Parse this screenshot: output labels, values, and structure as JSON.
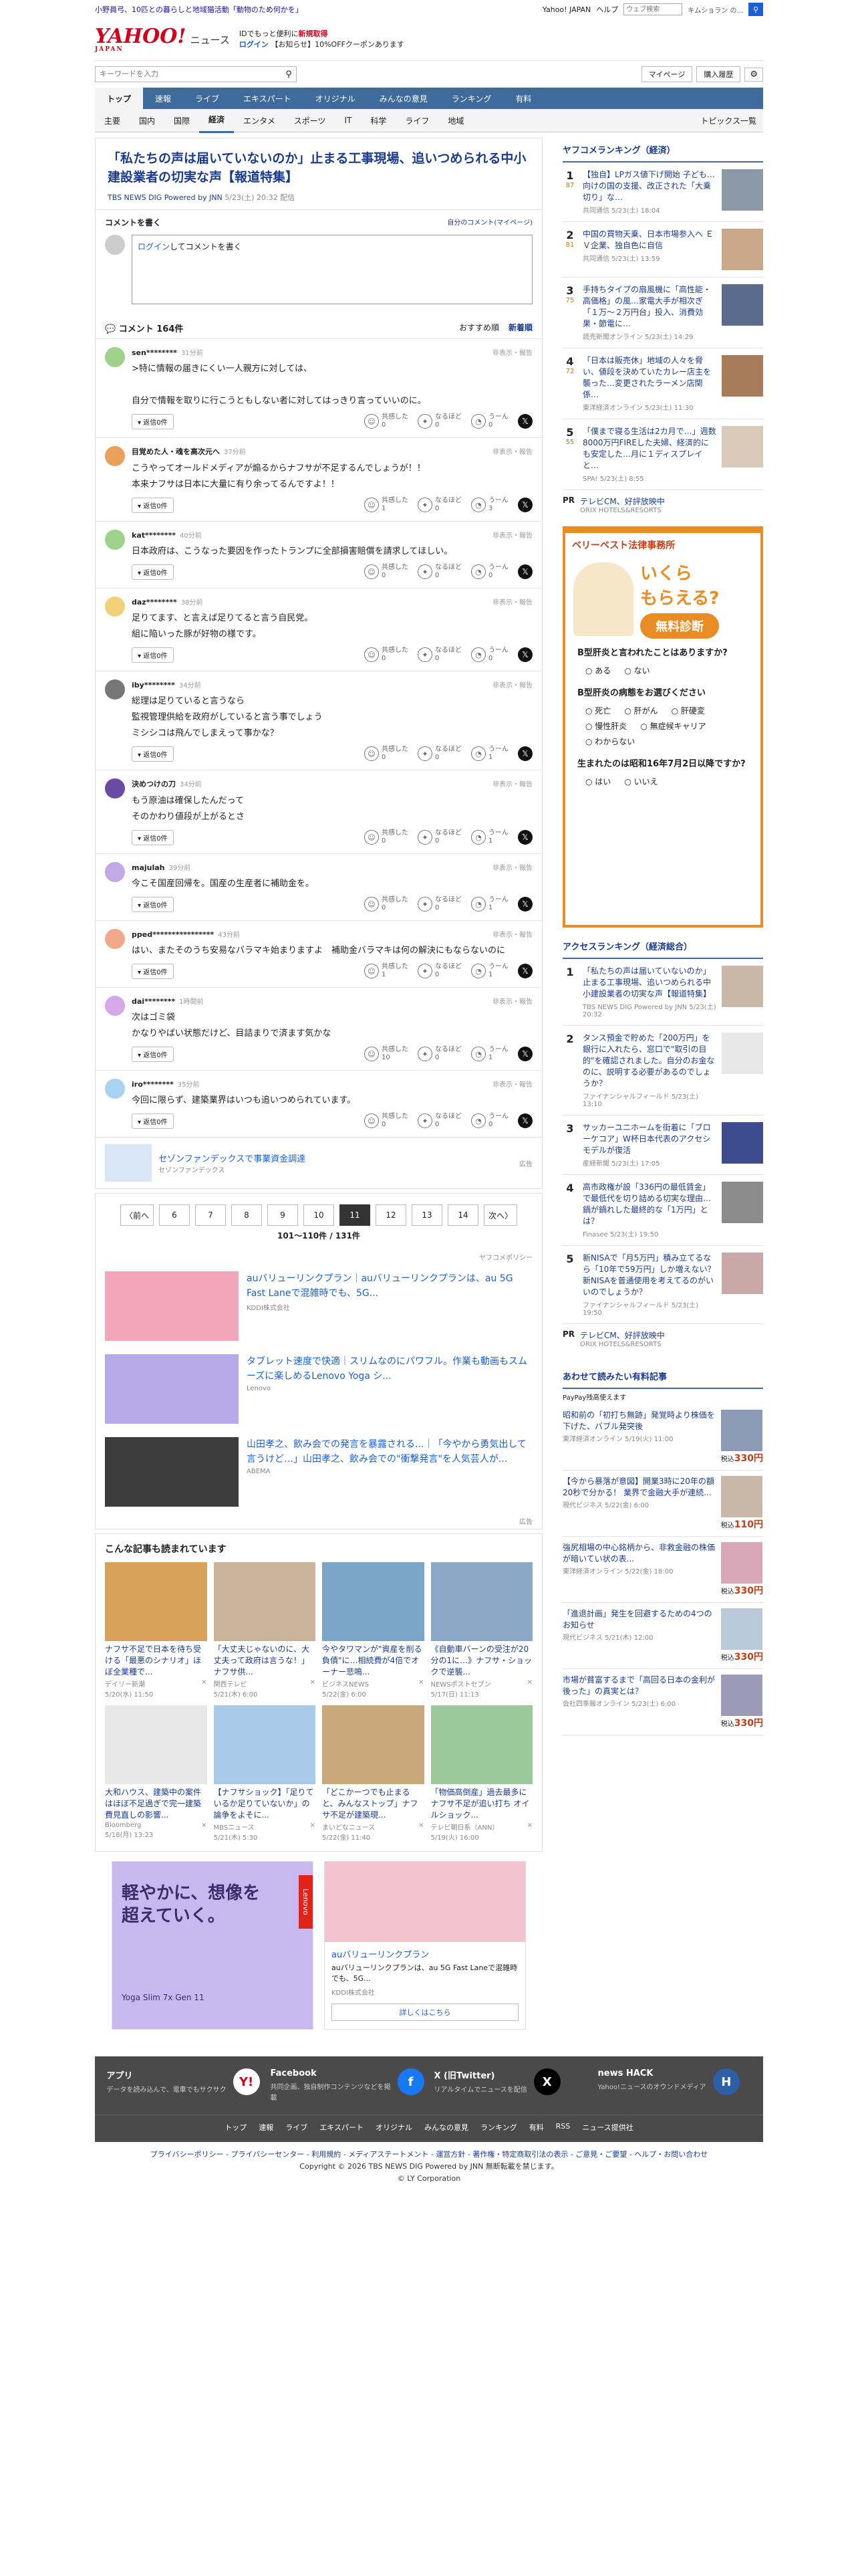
{
  "topbar": {
    "promo_link": "小野員弓、10匹との暮らしと地域猫活動「動物のため何かを」",
    "links": [
      "Yahoo! JAPAN",
      "ヘルプ"
    ],
    "search_placeholder": "ウェブ検索",
    "search_hint": "キムショラン の..."
  },
  "header": {
    "logo": "YAHOO!",
    "logo_sub": "JAPAN",
    "service": "ニュース",
    "promo_line1": "IDでもっと便利に",
    "promo_red": "新規取得",
    "promo_login": "ログイン",
    "promo_line2": "【お知らせ】10%OFFクーポンあります",
    "search_placeholder": "キーワードを入力",
    "mypage": "マイページ",
    "purchase": "購入履歴"
  },
  "nav_main": [
    {
      "label": "トップ",
      "active": true
    },
    {
      "label": "速報"
    },
    {
      "label": "ライブ"
    },
    {
      "label": "エキスパート"
    },
    {
      "label": "オリジナル"
    },
    {
      "label": "みんなの意見"
    },
    {
      "label": "ランキング"
    },
    {
      "label": "有料"
    }
  ],
  "nav_sub": [
    {
      "label": "主要"
    },
    {
      "label": "国内"
    },
    {
      "label": "国際"
    },
    {
      "label": "経済",
      "active": true
    },
    {
      "label": "エンタメ"
    },
    {
      "label": "スポーツ"
    },
    {
      "label": "IT"
    },
    {
      "label": "科学"
    },
    {
      "label": "ライフ"
    },
    {
      "label": "地域"
    }
  ],
  "nav_sub_right": "トピックス一覧",
  "article": {
    "title": "「私たちの声は届いていないのか」止まる工事現場、追いつめられる中小建設業者の切実な声【報道特集】",
    "source": "TBS NEWS DIG Powered by JNN",
    "date": "5/23(土) 20:32 配信"
  },
  "comment_form": {
    "heading": "コメントを書く",
    "my_comments": "自分のコメント(マイページ)",
    "login": "ログイン",
    "placeholder": "してコメントを書く"
  },
  "comments_header": {
    "count": "コメント 164件",
    "sort_recommended": "おすすめ順",
    "sort_new": "新着順"
  },
  "reaction_labels": {
    "agree": "共感した",
    "insight": "なるほど",
    "hmm": "うーん",
    "reply": "返信0件",
    "report": "非表示・報告"
  },
  "comments": [
    {
      "user": "sen********",
      "time": "31分前",
      "text": ">特に情報の届きにくい一人親方に対しては、\n\n自分で情報を取りに行こうともしない者に対してはっきり言っていいのに。",
      "agree": "0",
      "insight": "0",
      "hmm": "0",
      "color": "#9ed28b"
    },
    {
      "user": "目覚めた人・魂を高次元へ",
      "time": "37分前",
      "text": "こうやってオールドメディアが煽るからナフサが不足するんでしょうが！！\n本来ナフサは日本に大量に有り余ってるんですよ！！",
      "agree": "1",
      "insight": "0",
      "hmm": "3",
      "color": "#e9a15a"
    },
    {
      "user": "kat********",
      "time": "40分前",
      "text": "日本政府は、こうなった要因を作ったトランプに全部損害賠償を請求してほしい。",
      "agree": "0",
      "insight": "0",
      "hmm": "0",
      "color": "#9ed28b"
    },
    {
      "user": "daz********",
      "time": "38分前",
      "text": "足りてます、と言えば足りてると言う自民党。\n組に陥いった豚が好物の様です。",
      "agree": "0",
      "insight": "0",
      "hmm": "0",
      "color": "#f1d27a"
    },
    {
      "user": "iby********",
      "time": "34分前",
      "text": "総理は足りていると言うなら\n監視管理供給を政府がしていると言う事でしょう\nミシシコは飛んでしまえって事かな？",
      "agree": "0",
      "insight": "0",
      "hmm": "1",
      "color": "#777777"
    },
    {
      "user": "決めつけの刀",
      "time": "34分前",
      "text": "もう原油は確保したんだって\nそのかわり値段が上がるとさ",
      "agree": "0",
      "insight": "0",
      "hmm": "1",
      "color": "#6a4ba2"
    },
    {
      "user": "majulah",
      "time": "39分前",
      "text": "今こそ国産回帰を。国産の生産者に補助金を。",
      "agree": "0",
      "insight": "0",
      "hmm": "1",
      "color": "#c3a8e8"
    },
    {
      "user": "pped****************",
      "time": "43分前",
      "text": "はい、またそのうち安易なバラマキ始まりますよ　補助金バラマキは何の解決にもならないのに",
      "agree": "1",
      "insight": "0",
      "hmm": "1",
      "color": "#f0a98a"
    },
    {
      "user": "dai********",
      "time": "1時間前",
      "text": "次はゴミ袋\nかなりやばい状態だけど、目詰まりで済ます気かな",
      "agree": "10",
      "insight": "0",
      "hmm": "1",
      "color": "#d7a8e8"
    },
    {
      "user": "iro********",
      "time": "35分前",
      "text": "今回に限らず、建築業界はいつも追いつめられています。",
      "agree": "0",
      "insight": "0",
      "hmm": "0",
      "color": "#a8d2f0"
    }
  ],
  "inline_ad": {
    "title": "セゾンファンデックスで事業資金調達",
    "sub": "セゾンファンデックス",
    "label": "広告"
  },
  "pager": {
    "prev": "〈前へ",
    "next": "次へ〉",
    "pages": [
      "6",
      "7",
      "8",
      "9",
      "10",
      "11",
      "12",
      "13",
      "14"
    ],
    "current": "11",
    "range": "101〜110件 / 131件",
    "policy": "ヤフコメポリシー"
  },
  "ads": [
    {
      "title": "auバリューリンクプラン｜auバリューリンクプランは、au 5G Fast Laneで混雑時でも、5G...",
      "sub": "KDDI株式会社",
      "color": "#f3a6b8"
    },
    {
      "title": "タブレット速度で快適｜スリムなのにパワフル。作業も動画もスムーズに楽しめるLenovo Yoga シ...",
      "sub": "Lenovo",
      "color": "#b7a9e8"
    },
    {
      "title": "山田孝之、飲み会での発言を暴露される...｜「今やから勇気出して言うけど…」山田孝之、飲み会での\"衝撃発言\"を人気芸人が...",
      "sub": "ABEMA",
      "color": "#3c3c3c"
    }
  ],
  "ad_label": "広告",
  "reco": {
    "heading": "こんな記事も読まれています",
    "items": [
      {
        "title": "ナフサ不足で日本を待ち受ける「最悪のシナリオ」ほぼ全業種で...",
        "src": "デイリー新潮",
        "date": "5/20(水) 11:50",
        "color": "#d9a25a"
      },
      {
        "title": "「大丈夫じゃないのに、大丈夫って政府は言うな！」ナフサ供...",
        "src": "関西テレビ",
        "date": "5/21(木) 6:00",
        "color": "#c9b49b"
      },
      {
        "title": "今やタワマンが\"資産を削る負債\"に…相続費が4倍でオーナー悲鳴...",
        "src": "ビジネスNEWS",
        "date": "5/22(金) 6:00",
        "color": "#7ba4c9"
      },
      {
        "title": "《自動車バーンの受注が20分の1に…》ナフサ・ショックで逆襲...",
        "src": "NEWSポストセブン",
        "date": "5/17(日) 11:13",
        "color": "#8aa8c5"
      },
      {
        "title": "大和ハウス、建築中の案件はほぼ不足過ぎで完一建築費見直しの影響...",
        "src": "Bloomberg",
        "date": "5/18(月) 13:23",
        "color": "#e8e8e8"
      },
      {
        "title": "【ナフサショック】「足りているか足りていないか」の論争をよそに...",
        "src": "MBSニュース",
        "date": "5/21(木) 5:30",
        "color": "#a8c9e8"
      },
      {
        "title": "「どこかーつでも止まると、みんなストップ」ナフサ不足が建築現...",
        "src": "まいどなニュース",
        "date": "5/22(金) 11:40",
        "color": "#c9a87b"
      },
      {
        "title": "「物価高倒産」過去最多に ナフサ不足が追い打ち オイルショック...",
        "src": "テレビ朝日系（ANN）",
        "date": "5/19(火) 16:00",
        "color": "#9bc99b"
      }
    ]
  },
  "big_ads": [
    {
      "headline": "軽やかに、想像を超えていく。",
      "product": "Yoga Slim 7x Gen 11",
      "brand": "Lenovo",
      "color": "#c9b8f0"
    },
    {
      "title": "auバリューリンクプラン",
      "desc": "auバリューリンクプランは、au 5G Fast Laneで混雑時でも、5G...",
      "sub": "KDDI株式会社",
      "more": "詳しくはこちら",
      "color": "#f3c4d0"
    }
  ],
  "side": {
    "ranking_heading": "ヤフコメランキング（経済）",
    "ranking": [
      {
        "n": "1",
        "c": "87",
        "title": "【独自】LPガス値下げ開始 子ども…向けの国の支援、改正された「大乗切り」な…",
        "src": "共同通信 5/23(土) 18:04",
        "color": "#8c9aa8"
      },
      {
        "n": "2",
        "c": "81",
        "title": "中国の買物天乗、日本市場参入へ ＥＶ企業、独自色に自信",
        "src": "共同通信 5/23(土) 13:59",
        "color": "#c9a88a"
      },
      {
        "n": "3",
        "c": "75",
        "title": "手持ちタイプの扇風機に「高性能・高価格」の風…家電大手が相次ぎ「１万〜２万円台」投入、消費効果・節電に…",
        "src": "読売新聞オンライン 5/23(土) 14:29",
        "color": "#5a6b8c"
      },
      {
        "n": "4",
        "c": "72",
        "title": "「日本は販売休」地域の人々を脅い、値段を決めていたカレー店主を襲った…変更されたラーメン店関係…",
        "src": "東洋経済オンライン 5/23(土) 11:30",
        "color": "#a87b5a"
      },
      {
        "n": "5",
        "c": "55",
        "title": "「僕まで寝る生活は2カ月で…」週数8000万円FIREした夫婦、経済的にも安定した…月に１ディスプレイと…",
        "src": "SPA! 5/23(土) 8:55",
        "color": "#d9c9b8"
      }
    ],
    "pr1": {
      "label": "PR",
      "title": "テレビCM、好評放映中",
      "sub": "ORIX HOTELS&RESORTS"
    },
    "law_ad": {
      "firm": "ベリーベスト法律事務所",
      "catch1": "いくら",
      "catch2": "もらえる?",
      "catch3": "無料診断",
      "q1": "B型肝炎と言われたことはありますか?",
      "q1_opts": [
        "ある",
        "ない"
      ],
      "q2": "B型肝炎の病態をお選びください",
      "q2_opts": [
        "死亡",
        "肝がん",
        "肝硬変",
        "慢性肝炎",
        "無症候キャリア",
        "わからない"
      ],
      "q3": "生まれたのは昭和16年7月2日以降ですか?",
      "q3_opts": [
        "はい",
        "いいえ"
      ]
    },
    "access_heading": "アクセスランキング（経済総合）",
    "access": [
      {
        "n": "1",
        "title": "「私たちの声は届いていないのか」止まる工事現場、追いつめられる中小建設業者の切実な声【報道特集】",
        "src": "TBS NEWS DIG Powered by JNN 5/23(土) 20:32",
        "color": "#c9b8a8"
      },
      {
        "n": "2",
        "title": "タンス預金で貯めた「200万円」を銀行に入れたら、窓口で\"取引の目的\"を確認されました。自分のお金なのに、説明する必要があるのでしょうか？",
        "src": "ファイナンシャルフィールド 5/23(土) 13:10",
        "color": "#e8e8e8"
      },
      {
        "n": "3",
        "title": "サッカーユニホームを街着に「ブローケコア」W杯日本代表のアクセシモデルが復活",
        "src": "産経新聞 5/23(土) 17:05",
        "color": "#3c4c8c"
      },
      {
        "n": "4",
        "title": "高市政権が設「336円の最低賃金」で最低代を切り詰める切実な理由…鍋が鍋れした最終的な「1万円」とは？",
        "src": "Finasee 5/23(土) 19:50",
        "color": "#8c8c8c"
      },
      {
        "n": "5",
        "title": "新NISAで「月5万円」積み立てるなら「10年で59万円」しか増えない？ 新NISAを普通使用を考えてるのがいいのでしょうか？",
        "src": "ファイナンシャルフィールド 5/23(土) 19:50",
        "color": "#c9a8a8"
      }
    ],
    "pr2": {
      "label": "PR",
      "title": "テレビCM、好評放映中",
      "sub": "ORIX HOTELS&RESORTS"
    },
    "paid_heading": "あわせて読みたい有料記事",
    "paid_sub": "PayPay残高使えます",
    "paid": [
      {
        "title": "昭和前の「初打ち無跡」発覚時より株価を下げた、バブル発突後",
        "src": "東洋経済オンライン 5/19(火) 11:00",
        "price": "330円",
        "color": "#8c9ab8"
      },
      {
        "title": "【今から暴落が意図】開業3時に20年の額 20秒で分かる！ 業界で金融大手が連続...",
        "src": "現代ビジネス 5/22(金) 6:00",
        "price": "110円",
        "color": "#c9b8a8"
      },
      {
        "title": "強尻相場の中心銘柄から、非救金融の株価が暗いてい状の表...",
        "src": "東洋経済オンライン 5/22(金) 18:00",
        "price": "330円",
        "color": "#d9a8b8"
      },
      {
        "title": "「進退計画」発生を回避するための4つのお知らせ",
        "src": "現代ビジネス 5/21(木) 12:00",
        "price": "330円",
        "color": "#b8c9d9"
      },
      {
        "title": "市場が貧富するまで「高回る日本の金利が後った」の真実とは？",
        "src": "会社四季報オンライン 5/23(土) 6:00",
        "price": "330円",
        "color": "#9b9bb8"
      }
    ],
    "price_prefix": "税込"
  },
  "footer": {
    "apps": [
      {
        "title": "アプリ",
        "desc": "データを読み込んで、電車でもサクサク",
        "icon": "Y!",
        "color": "#ffffff"
      },
      {
        "title": "Facebook",
        "desc": "共同企画、独自制作コンテンツなどを掲載",
        "icon": "f",
        "color": "#1877f2"
      },
      {
        "title": "X (旧Twitter)",
        "desc": "リアルタイムでニュースを配信",
        "icon": "X",
        "color": "#000000"
      },
      {
        "title": "news HACK",
        "desc": "Yahoo!ニュースのオウンドメディア",
        "icon": "H",
        "color": "#2c5fa8"
      }
    ],
    "links": [
      "トップ",
      "速報",
      "ライブ",
      "エキスパート",
      "オリジナル",
      "みんなの意見",
      "ランキング",
      "有料",
      "RSS",
      "ニュース提供社"
    ],
    "legal_links": "プライバシーポリシー - プライバシーセンター - 利用規約 - メディアステートメント - 運営方針 - 著作権・特定商取引法の表示 - ご意見・ご要望 - ヘルプ・お問い合わせ",
    "copyright": "Copyright © 2026 TBS NEWS DIG Powered by JNN 無断転載を禁じます。",
    "copyright2": "© LY Corporation"
  }
}
